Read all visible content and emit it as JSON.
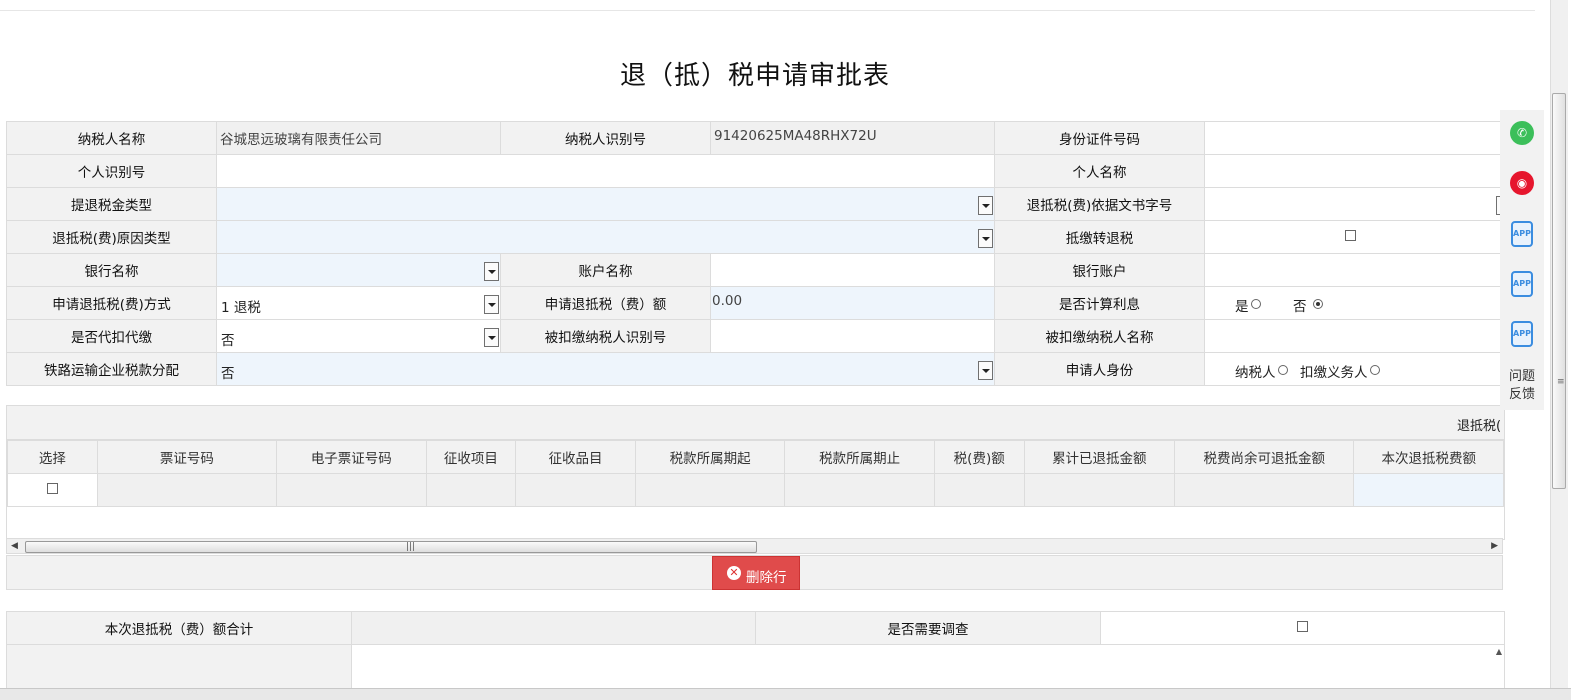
{
  "page": {
    "title": "退（抵）税申请审批表"
  },
  "form": {
    "taxpayer_name_label": "纳税人名称",
    "taxpayer_name_value": "谷城思远玻璃有限责任公司",
    "taxpayer_id_label": "纳税人识别号",
    "taxpayer_id_value": "91420625MA48RHX72U",
    "id_doc_label": "身份证件号码",
    "personal_id_label": "个人识别号",
    "personal_name_label": "个人名称",
    "refund_type_label": "提退税金类型",
    "refund_doc_label": "退抵税(费)依据文书字号",
    "reason_label": "退抵税(费)原因类型",
    "offset_label": "抵缴转退税",
    "bank_label": "银行名称",
    "account_name_label": "账户名称",
    "bank_account_label": "银行账户",
    "method_label": "申请退抵税(费)方式",
    "method_value": "1 退税",
    "amount_label": "申请退抵税（费）额",
    "amount_value": "0.00",
    "interest_label": "是否计算利息",
    "interest_yes": "是",
    "interest_no": "否",
    "withhold_label": "是否代扣代缴",
    "withhold_value": "否",
    "withheld_id_label": "被扣缴纳税人识别号",
    "withheld_name_label": "被扣缴纳税人名称",
    "railway_label": "铁路运输企业税款分配",
    "railway_value": "否",
    "applicant_label": "申请人身份",
    "applicant_taxpayer": "纳税人",
    "applicant_withholder": "扣缴义务人"
  },
  "grid": {
    "caption": "退抵税(",
    "columns": [
      "选择",
      "票证号码",
      "电子票证号码",
      "征收项目",
      "征收品目",
      "税款所属期起",
      "税款所属期止",
      "税(费)额",
      "累计已退抵金额",
      "税费尚余可退抵金额",
      "本次退抵税费额"
    ]
  },
  "actions": {
    "delete_row": "删除行"
  },
  "summary": {
    "total_label": "本次退抵税（费）额合计",
    "investigate_label": "是否需要调查"
  },
  "sidebar": {
    "app1": "APP",
    "app2": "APP",
    "app3": "APP",
    "feedback": "问题反馈"
  },
  "colors": {
    "delete_button": "#e04b4b",
    "selectable_bg": "#eef5fc",
    "wechat": "#3cbf5a",
    "weibo": "#e6162d"
  }
}
